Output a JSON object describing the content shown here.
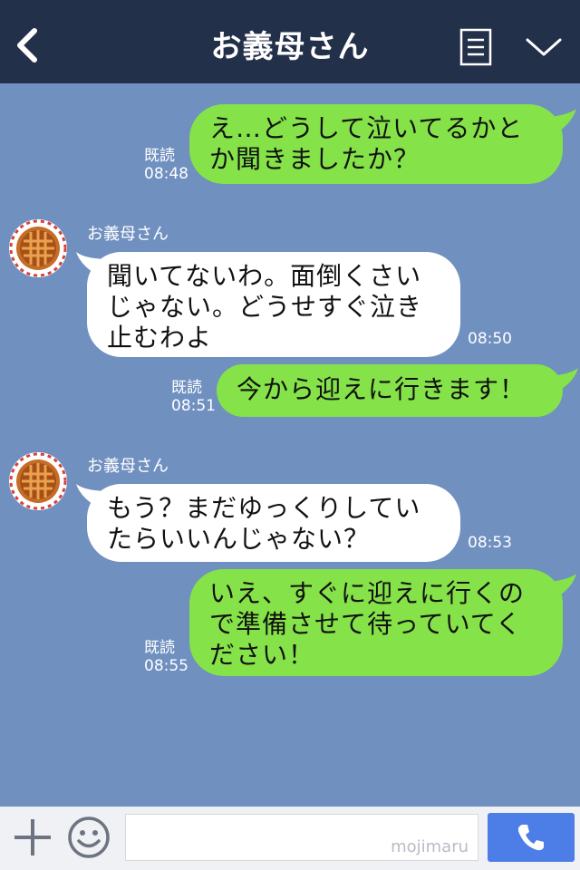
{
  "header": {
    "title": "お義母さん"
  },
  "messages": [
    {
      "side": "right",
      "text": "え…どうして泣いてるかと\nか聞きましたか？",
      "read": "既読",
      "time": "08:48"
    },
    {
      "side": "left",
      "sender": "お義母さん",
      "text": "聞いてないわ。面倒くさい\nじゃない。どうせすぐ泣き\n止むわよ",
      "time": "08:50"
    },
    {
      "side": "right",
      "text": "今から迎えに行きます！",
      "read": "既読",
      "time": "08:51"
    },
    {
      "side": "left",
      "sender": "お義母さん",
      "text": "もう？まだゆっくりしてい\nたらいいんじゃない？",
      "time": "08:53"
    },
    {
      "side": "right",
      "text": "いえ、すぐに迎えに行くの\nで準備させて待っていてく\nださい！",
      "read": "既読",
      "time": "08:55"
    }
  ],
  "footer": {
    "watermark": "mojimaru"
  },
  "colors": {
    "chat_background": "#7090c0",
    "header_background": "#233049",
    "sent_bubble": "#85e249",
    "received_bubble": "#ffffff",
    "call_button": "#4d7ee8"
  },
  "icons": [
    "back-arrow-icon",
    "menu-icon",
    "chevron-down-icon",
    "plus-icon",
    "smiley-icon",
    "phone-icon"
  ]
}
